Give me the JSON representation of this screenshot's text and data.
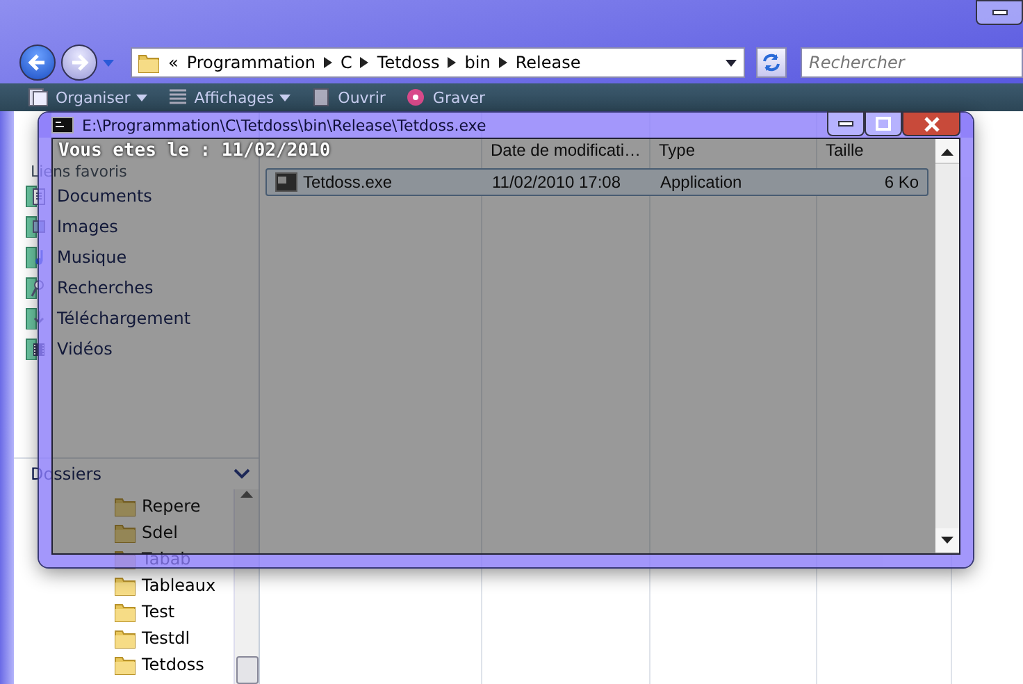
{
  "nav": {
    "overflow": "«",
    "breadcrumbs": [
      "Programmation",
      "C",
      "Tetdoss",
      "bin",
      "Release"
    ],
    "search": {
      "placeholder": "Rechercher"
    }
  },
  "toolbar": [
    {
      "label": "Organiser",
      "kind": "organize",
      "dropdown": true
    },
    {
      "label": "Affichages",
      "kind": "views",
      "dropdown": true
    },
    {
      "label": "Ouvrir",
      "kind": "open",
      "dropdown": false
    },
    {
      "label": "Graver",
      "kind": "burn",
      "dropdown": false
    }
  ],
  "favorites": {
    "title": "Liens favoris",
    "items": [
      {
        "label": "Documents",
        "kind": "documents"
      },
      {
        "label": "Images",
        "kind": "images"
      },
      {
        "label": "Musique",
        "kind": "music"
      },
      {
        "label": "Recherches",
        "kind": "search"
      },
      {
        "label": "Téléchargement",
        "kind": "downloads"
      },
      {
        "label": "Vidéos",
        "kind": "videos"
      }
    ]
  },
  "folders": {
    "title": "Dossiers",
    "items": [
      "Repere",
      "Sdel",
      "Tabab",
      "Tableaux",
      "Test",
      "Testdl",
      "Tetdoss"
    ]
  },
  "file_list": {
    "columns": [
      "Date de modificati…",
      "Type",
      "Taille"
    ],
    "rows": [
      {
        "name": "Tetdoss.exe",
        "date": "11/02/2010 17:08",
        "type": "Application",
        "size": "6 Ko",
        "selected": true
      }
    ]
  },
  "console": {
    "title": "E:\\Programmation\\C\\Tetdoss\\bin\\Release\\Tetdoss.exe",
    "lines": [
      "Vous etes le : 11/02/2010"
    ]
  }
}
